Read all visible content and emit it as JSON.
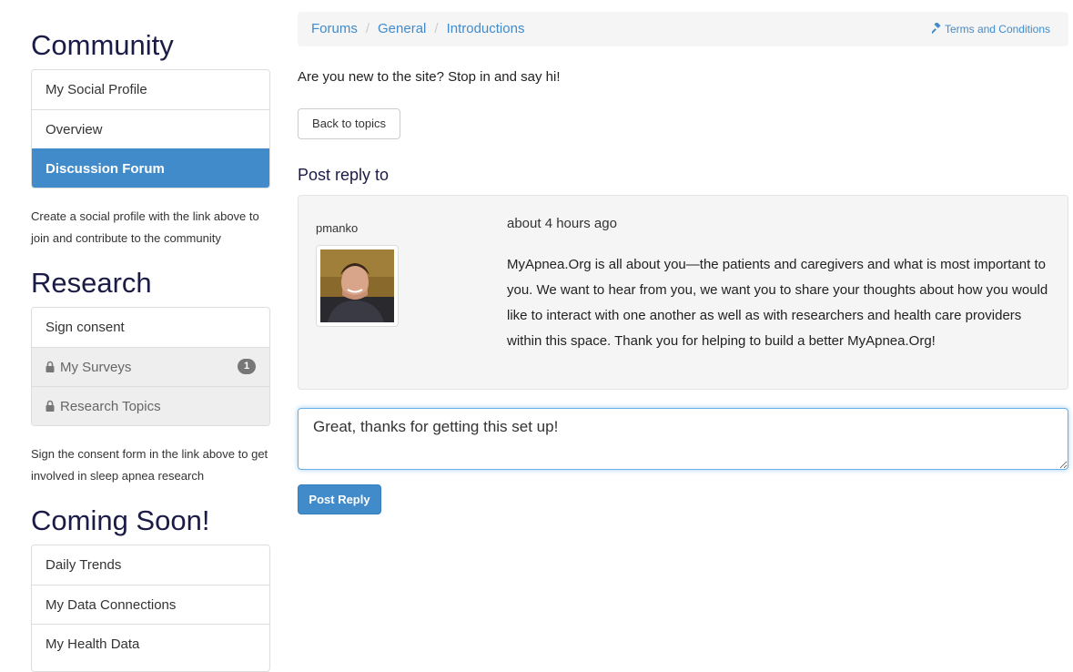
{
  "sidebar": {
    "community": {
      "heading": "Community",
      "items": [
        {
          "label": "My Social Profile"
        },
        {
          "label": "Overview"
        },
        {
          "label": "Discussion Forum"
        }
      ],
      "note": "Create a social profile with the link above to join and contribute to the community"
    },
    "research": {
      "heading": "Research",
      "items": [
        {
          "label": "Sign consent"
        },
        {
          "label": "My Surveys",
          "badge": "1"
        },
        {
          "label": "Research Topics"
        }
      ],
      "note": "Sign the consent form in the link above to get involved in sleep apnea research"
    },
    "coming_soon": {
      "heading": "Coming Soon!",
      "items": [
        {
          "label": "Daily Trends"
        },
        {
          "label": "My Data Connections"
        },
        {
          "label": "My Health Data"
        }
      ]
    }
  },
  "breadcrumb": {
    "items": [
      "Forums",
      "General",
      "Introductions"
    ],
    "separator": "/",
    "terms_label": "Terms and Conditions"
  },
  "forum": {
    "description": "Are you new to the site? Stop in and say hi!",
    "back_button": "Back to topics",
    "post_heading": "Post reply to"
  },
  "post": {
    "username": "pmanko",
    "timestamp": "about 4 hours ago",
    "body": "MyApnea.Org is all about you—the patients and caregivers and what is most important to you. We want to hear from you, we want you to share your thoughts about how you would like to interact with one another as well as with researchers and health care providers within this space. Thank you for helping to build a better MyApnea.Org!"
  },
  "reply": {
    "value": "Great, thanks for getting this set up!",
    "submit_label": "Post Reply"
  },
  "colors": {
    "primary": "#428bca",
    "heading": "#1b1b47",
    "badge": "#777777"
  }
}
